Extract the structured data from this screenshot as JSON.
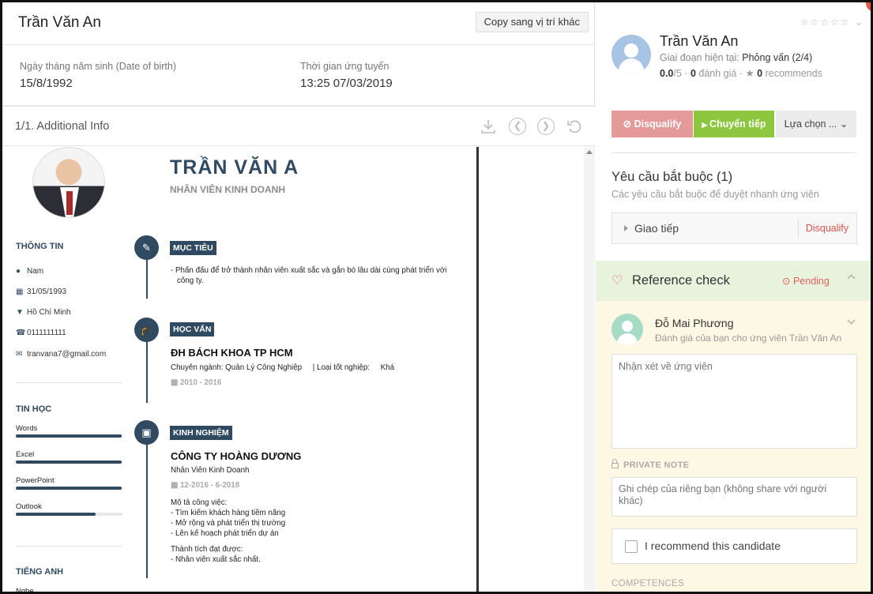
{
  "header": {
    "candidate_name": "Trần Văn An",
    "copy_button": "Copy sang vị trí khác"
  },
  "meta": {
    "dob_label": "Ngày tháng năm sinh (Date of birth)",
    "dob_value": "15/8/1992",
    "applied_label": "Thời gian ứng tuyển",
    "applied_value": "13:25 07/03/2019"
  },
  "attachment": {
    "title": "1/1. Additional Info"
  },
  "cv": {
    "name": "TRẦN VĂN A",
    "role": "NHÂN VIÊN KINH DOANH",
    "info_heading": "THÔNG TIN",
    "gender": "Nam",
    "birthday": "31/05/1993",
    "location": "Hồ Chí Minh",
    "phone": "0111111111",
    "email": "tranvana7@gmail.com",
    "it_heading": "TIN HỌC",
    "skills": [
      {
        "name": "Words",
        "level": 0.99
      },
      {
        "name": "Excel",
        "level": 0.99
      },
      {
        "name": "PowerPoint",
        "level": 0.99
      },
      {
        "name": "Outlook",
        "level": 0.75
      }
    ],
    "english_heading": "TIẾNG ANH",
    "english_sub": "Nghe",
    "objective_heading": "MỤC TIÊU",
    "objective_line1": "- Phấn đấu để trở thành nhân viên xuất sắc và gắn bó lâu dài cùng phát triển với",
    "objective_line2": "công ty.",
    "education_heading": "HỌC VẤN",
    "school": "ĐH BÁCH KHOA TP HCM",
    "major": "Chuyên ngành: Quản Lý Công Nghiệp     | Loại tốt nghiệp:     Khá",
    "edu_dates": "2010 - 2016",
    "experience_heading": "KINH NGHIỆM",
    "company": "CÔNG TY HOÀNG DƯƠNG",
    "position": "Nhân Viên Kinh Doanh",
    "exp_dates": "12-2016 - 6-2018",
    "desc_label": "Mô tả công việc:",
    "desc_1": "- Tìm kiếm khách hàng tiềm năng",
    "desc_2": "- Mở rộng và phát triển thị trường",
    "desc_3": "- Lên kế hoạch phát triển dự án",
    "achieve_label": "Thành tích đạt được:",
    "achieve_1": "- Nhân viên xuất sắc nhất."
  },
  "profile": {
    "name": "Trần Văn An",
    "stage_label": "Giai đoạn hiện tại:",
    "stage_value": "Phỏng vấn (2/4)",
    "score": "0.0",
    "score_max": "/5",
    "reviews_count": "0",
    "reviews_label": "đánh giá",
    "recommends_count": "0",
    "recommends_label": "recommends"
  },
  "actions": {
    "disqualify": "Disqualify",
    "forward": "Chuyển tiếp",
    "options": "Lựa chọn ..."
  },
  "requirements": {
    "title": "Yêu cầu bắt buộc (1)",
    "subtitle": "Các yêu cầu bắt buộc để duyệt nhanh ứng viên",
    "item_label": "Giao tiếp",
    "item_action": "Disqualify"
  },
  "reference": {
    "title": "Reference check",
    "status": "Pending",
    "reviewer_name": "Đỗ Mai Phương",
    "reviewer_sub": "Đánh giá của bạn cho ứng viên Trần Văn An",
    "comment_placeholder": "Nhận xét về ứng viên",
    "private_note_label": "PRIVATE NOTE",
    "note_placeholder": "Ghi chép của riêng bạn (không share với người khác)",
    "recommend_label": "I recommend this candidate",
    "competences_label": "COMPETENCES"
  },
  "colors": {
    "cv_accent": "#2f4a61",
    "disqualify": "#e59a9a",
    "forward": "#8dc63f",
    "reference_bg": "#fcf8e4",
    "reference_header_bg": "#e8f3de"
  }
}
